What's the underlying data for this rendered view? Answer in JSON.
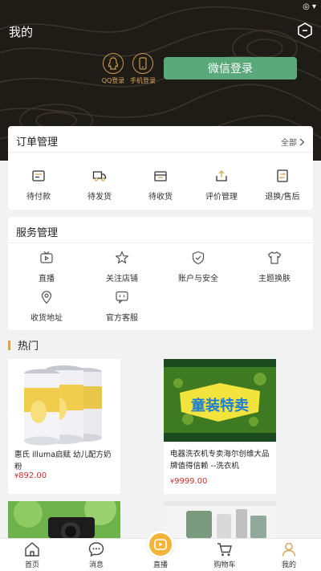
{
  "status": {
    "icons": "◎ ▾"
  },
  "header": {
    "title": "我的"
  },
  "login": {
    "qq_label": "QQ登录",
    "phone_label": "手机登录",
    "wechat_label": "微信登录"
  },
  "orders": {
    "title": "订单管理",
    "all_label": "全部",
    "items": [
      {
        "label": "待付款",
        "icon": "wallet-icon"
      },
      {
        "label": "待发货",
        "icon": "truck-icon"
      },
      {
        "label": "待收货",
        "icon": "box-icon"
      },
      {
        "label": "评价管理",
        "icon": "review-icon"
      },
      {
        "label": "退换/售后",
        "icon": "return-icon"
      }
    ]
  },
  "services": {
    "title": "服务管理",
    "items": [
      {
        "label": "直播",
        "icon": "tv-icon"
      },
      {
        "label": "关注店铺",
        "icon": "star-icon"
      },
      {
        "label": "账户与安全",
        "icon": "shield-icon"
      },
      {
        "label": "主题换肤",
        "icon": "tshirt-icon"
      },
      {
        "label": "收货地址",
        "icon": "location-icon"
      },
      {
        "label": "官方客服",
        "icon": "chat-icon"
      }
    ]
  },
  "hot": {
    "title": "热门",
    "products": [
      {
        "name": "惠氏 illuma启赋 幼儿配方奶粉",
        "currency": "¥",
        "price": "892.00"
      },
      {
        "name": "电器洗衣机专卖海尔创维大品牌值得信赖 --洗衣机",
        "currency": "¥",
        "price": "9999.00"
      },
      {
        "name": "",
        "currency": "",
        "price": ""
      },
      {
        "name": "",
        "currency": "",
        "price": ""
      }
    ],
    "banner_text": "童装特卖"
  },
  "tabbar": {
    "items": [
      {
        "label": "首页",
        "icon": "home-icon"
      },
      {
        "label": "消息",
        "icon": "message-icon"
      },
      {
        "label": "直播",
        "icon": "live-icon"
      },
      {
        "label": "购物车",
        "icon": "cart-icon"
      },
      {
        "label": "我的",
        "icon": "user-icon"
      }
    ],
    "active_color": "#d6a75b"
  },
  "colors": {
    "header_bg": "#1f1b17",
    "accent_gold": "#d6a75b",
    "wechat_green": "#5aa97a",
    "price_red": "#c4352b"
  }
}
